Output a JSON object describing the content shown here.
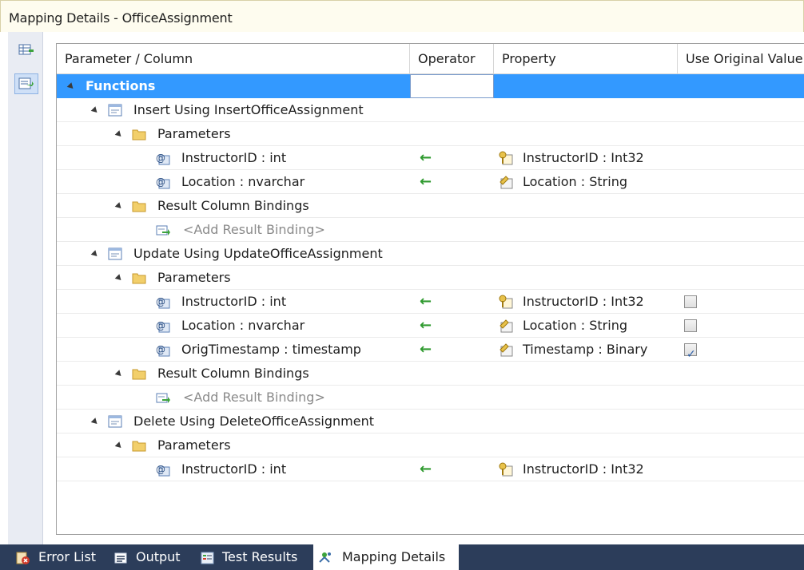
{
  "window": {
    "title": "Mapping Details - OfficeAssignment"
  },
  "columns": {
    "name": "Parameter / Column",
    "operator": "Operator",
    "property": "Property",
    "use_original_value": "Use Original Value"
  },
  "tree": {
    "functions": "Functions",
    "insert": {
      "label": "Insert Using InsertOfficeAssignment",
      "parameters": "Parameters",
      "p1": {
        "name": "InstructorID : int",
        "op": "←",
        "prop": "InstructorID : Int32"
      },
      "p2": {
        "name": "Location : nvarchar",
        "op": "←",
        "prop": "Location : String"
      },
      "result_bindings": "Result Column Bindings",
      "add_binding": "<Add Result Binding>"
    },
    "update": {
      "label": "Update Using UpdateOfficeAssignment",
      "parameters": "Parameters",
      "p1": {
        "name": "InstructorID : int",
        "op": "←",
        "prop": "InstructorID : Int32",
        "use_original": false
      },
      "p2": {
        "name": "Location : nvarchar",
        "op": "←",
        "prop": "Location : String",
        "use_original": false
      },
      "p3": {
        "name": "OrigTimestamp : timestamp",
        "op": "←",
        "prop": "Timestamp : Binary",
        "use_original": true
      },
      "result_bindings": "Result Column Bindings",
      "add_binding": "<Add Result Binding>"
    },
    "delete": {
      "label": "Delete Using DeleteOfficeAssignment",
      "parameters": "Parameters",
      "p1": {
        "name": "InstructorID : int",
        "op": "←",
        "prop": "InstructorID : Int32"
      }
    }
  },
  "tabs": {
    "error_list": "Error List",
    "output": "Output",
    "test_results": "Test Results",
    "mapping_details": "Mapping Details"
  },
  "colors": {
    "selection": "#3399ff",
    "tabbar": "#2c3d5a",
    "arrow": "#2f9a2f",
    "title_bg": "#fefcef"
  },
  "icons": {
    "folder": "folder-icon",
    "parameter": "parameter-icon",
    "key_property": "key-property-icon",
    "property": "property-icon",
    "function": "function-icon",
    "add_binding": "add-binding-icon"
  }
}
